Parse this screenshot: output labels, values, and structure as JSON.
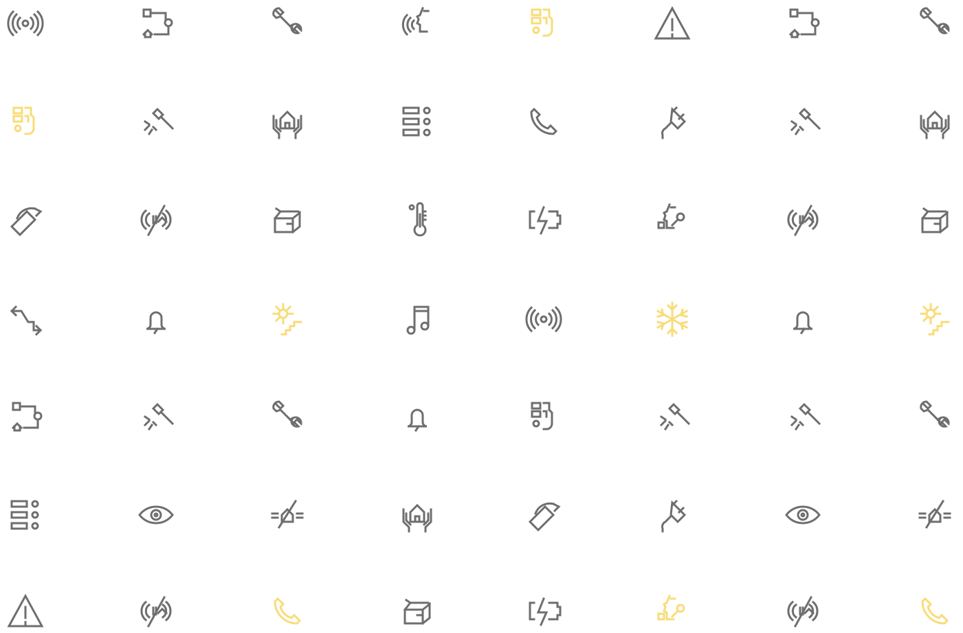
{
  "colors": {
    "default": "#6e6e6e",
    "highlight": "#f8dc78",
    "background": "#ffffff"
  },
  "grid": {
    "columns": 8,
    "rows": 7,
    "icons": [
      {
        "name": "broadcast-icon",
        "color": "default"
      },
      {
        "name": "house-flow-icon",
        "color": "default"
      },
      {
        "name": "wrench-icon",
        "color": "default"
      },
      {
        "name": "face-sound-icon",
        "color": "default"
      },
      {
        "name": "control-panel-icon",
        "color": "highlight"
      },
      {
        "name": "warning-triangle-icon",
        "color": "default"
      },
      {
        "name": "house-flow-icon",
        "color": "default"
      },
      {
        "name": "wrench-icon",
        "color": "default"
      },
      {
        "name": "control-panel-icon",
        "color": "highlight"
      },
      {
        "name": "impact-hammer-icon",
        "color": "default"
      },
      {
        "name": "hands-house-icon",
        "color": "default"
      },
      {
        "name": "list-settings-icon",
        "color": "default"
      },
      {
        "name": "phone-icon",
        "color": "default"
      },
      {
        "name": "plug-icon",
        "color": "default"
      },
      {
        "name": "impact-hammer-icon",
        "color": "default"
      },
      {
        "name": "hands-house-icon",
        "color": "default"
      },
      {
        "name": "tag-icon",
        "color": "default"
      },
      {
        "name": "broadcast-off-icon",
        "color": "default"
      },
      {
        "name": "open-box-icon",
        "color": "default"
      },
      {
        "name": "thermometer-icon",
        "color": "default"
      },
      {
        "name": "battery-charge-icon",
        "color": "default"
      },
      {
        "name": "face-connect-icon",
        "color": "default"
      },
      {
        "name": "broadcast-off-icon",
        "color": "default"
      },
      {
        "name": "open-box-icon",
        "color": "default"
      },
      {
        "name": "route-arrows-icon",
        "color": "default"
      },
      {
        "name": "bell-icon",
        "color": "default"
      },
      {
        "name": "sun-stairs-icon",
        "color": "highlight"
      },
      {
        "name": "music-note-icon",
        "color": "default"
      },
      {
        "name": "broadcast-icon",
        "color": "default"
      },
      {
        "name": "snowflake-icon",
        "color": "highlight"
      },
      {
        "name": "bell-icon",
        "color": "default"
      },
      {
        "name": "sun-stairs-icon",
        "color": "highlight"
      },
      {
        "name": "house-flow-icon",
        "color": "default"
      },
      {
        "name": "impact-hammer-icon",
        "color": "default"
      },
      {
        "name": "wrench-icon",
        "color": "default"
      },
      {
        "name": "bell-icon",
        "color": "default"
      },
      {
        "name": "control-panel-icon",
        "color": "default"
      },
      {
        "name": "impact-hammer-icon",
        "color": "default"
      },
      {
        "name": "impact-hammer-icon",
        "color": "default"
      },
      {
        "name": "wrench-icon",
        "color": "default"
      },
      {
        "name": "list-settings-icon",
        "color": "default"
      },
      {
        "name": "eye-icon",
        "color": "default"
      },
      {
        "name": "house-signal-off-icon",
        "color": "default"
      },
      {
        "name": "hands-house-icon",
        "color": "default"
      },
      {
        "name": "tag-icon",
        "color": "default"
      },
      {
        "name": "plug-icon",
        "color": "default"
      },
      {
        "name": "eye-icon",
        "color": "default"
      },
      {
        "name": "house-signal-off-icon",
        "color": "default"
      },
      {
        "name": "warning-triangle-icon",
        "color": "default"
      },
      {
        "name": "broadcast-off-icon",
        "color": "default"
      },
      {
        "name": "phone-icon",
        "color": "highlight"
      },
      {
        "name": "open-box-icon",
        "color": "default"
      },
      {
        "name": "battery-charge-icon",
        "color": "default"
      },
      {
        "name": "face-connect-icon",
        "color": "highlight"
      },
      {
        "name": "broadcast-off-icon",
        "color": "default"
      },
      {
        "name": "phone-icon",
        "color": "highlight"
      }
    ]
  }
}
